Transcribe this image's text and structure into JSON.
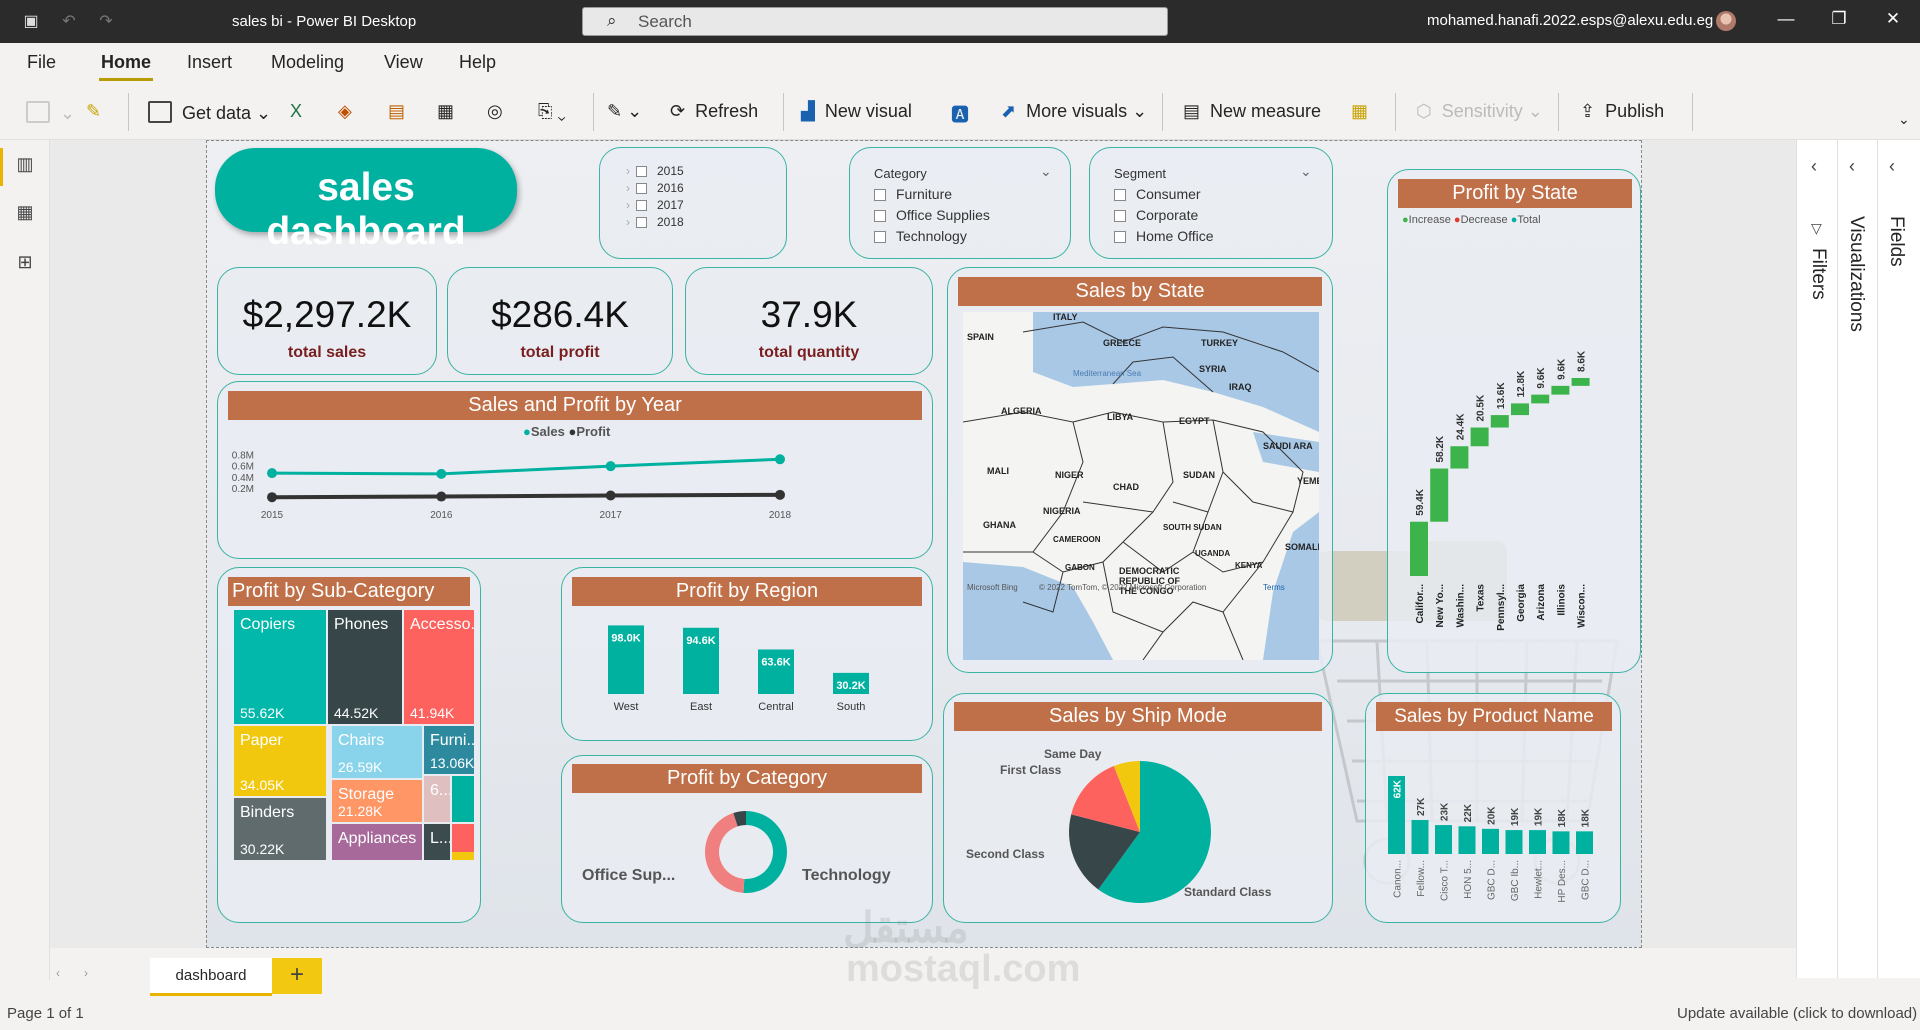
{
  "titlebar": {
    "title": "sales bi - Power BI Desktop",
    "search_placeholder": "Search",
    "user": "mohamed.hanafi.2022.esps@alexu.edu.eg"
  },
  "menu": [
    "File",
    "Home",
    "Insert",
    "Modeling",
    "View",
    "Help"
  ],
  "ribbon": {
    "get_data": "Get data",
    "refresh": "Refresh",
    "new_visual": "New visual",
    "more_visuals": "More visuals",
    "new_measure": "New measure",
    "sensitivity": "Sensitivity",
    "publish": "Publish"
  },
  "panes": {
    "filters": "Filters",
    "visualizations": "Visualizations",
    "fields": "Fields"
  },
  "dashboard": {
    "title": "sales dashboard"
  },
  "year_slicer": [
    "2015",
    "2016",
    "2017",
    "2018"
  ],
  "category_slicer": {
    "title": "Category",
    "items": [
      "Furniture",
      "Office Supplies",
      "Technology"
    ]
  },
  "segment_slicer": {
    "title": "Segment",
    "items": [
      "Consumer",
      "Corporate",
      "Home Office"
    ]
  },
  "kpis": [
    {
      "value": "$2,297.2K",
      "label": "total sales"
    },
    {
      "value": "$286.4K",
      "label": "total profit"
    },
    {
      "value": "37.9K",
      "label": "total quantity"
    }
  ],
  "sales_profit_year": {
    "title": "Sales and Profit by Year",
    "legend": [
      "Sales",
      "Profit"
    ],
    "yticks": [
      "0.8M",
      "0.6M",
      "0.4M",
      "0.2M"
    ]
  },
  "profit_by_subcategory": {
    "title": "Profit by Sub-Category"
  },
  "profit_by_region": {
    "title": "Profit by Region"
  },
  "profit_by_category": {
    "title": "Profit by Category",
    "labels": [
      "Office Sup...",
      "Technology"
    ]
  },
  "sales_by_state": {
    "title": "Sales by State",
    "map_labels": [
      "ITALY",
      "SPAIN",
      "GREECE",
      "TURKEY",
      "Mediterranean Sea",
      "SYRIA",
      "IRAQ",
      "ALGERIA",
      "LIBYA",
      "EGYPT",
      "SAUDI ARA",
      "MALI",
      "NIGER",
      "CHAD",
      "SUDAN",
      "YEME",
      "NIGERIA",
      "GHANA",
      "SOUTH SUDAN",
      "CAMEROON",
      "SOMALI",
      "UGANDA",
      "KENYA",
      "GABON",
      "DEMOCRATIC",
      "REPUBLIC OF",
      "THE CONGO"
    ],
    "attribution": "Microsoft Bing",
    "copyright": "© 2022 TomTom, © 2022 Microsoft Corporation",
    "terms": "Terms"
  },
  "profit_by_state": {
    "title": "Profit by State",
    "legend": [
      "Increase",
      "Decrease",
      "Total"
    ]
  },
  "sales_by_ship_mode": {
    "title": "Sales by Ship Mode",
    "labels": [
      "Same Day",
      "First Class",
      "Second Class",
      "Standard Class"
    ]
  },
  "sales_by_product": {
    "title": "Sales by Product Name"
  },
  "tabs": {
    "page": "dashboard",
    "add": "+"
  },
  "status": {
    "page": "Page 1 of 1",
    "update": "Update available (click to download)"
  },
  "watermark": {
    "arabic": "مستقل",
    "latin": "mostaql.com"
  },
  "colors": {
    "teal": "#00b1a0",
    "dark": "#374649",
    "red": "#fd625e",
    "yellow": "#f2c80f",
    "orange_banner": "#c07048",
    "green": "#3cb44b"
  },
  "chart_data": [
    {
      "type": "line",
      "title": "Sales and Profit by Year",
      "x": [
        "2015",
        "2016",
        "2017",
        "2018"
      ],
      "series": [
        {
          "name": "Sales",
          "values": [
            484000,
            470000,
            609000,
            733000
          ]
        },
        {
          "name": "Profit",
          "values": [
            50000,
            62000,
            81000,
            93000
          ]
        }
      ],
      "ylim": [
        0,
        900000
      ],
      "ytick_labels": [
        "0.2M",
        "0.4M",
        "0.6M",
        "0.8M"
      ]
    },
    {
      "type": "treemap",
      "title": "Profit by Sub-Category",
      "items": [
        {
          "name": "Copiers",
          "value": "55.62K",
          "color": "#01b8aa"
        },
        {
          "name": "Phones",
          "value": "44.52K",
          "color": "#374649"
        },
        {
          "name": "Accesso...",
          "value": "41.94K",
          "color": "#fd625e"
        },
        {
          "name": "Paper",
          "value": "34.05K",
          "color": "#f2c80f"
        },
        {
          "name": "Chairs",
          "value": "26.59K",
          "color": "#8ad4eb"
        },
        {
          "name": "Furni...",
          "value": "13.06K",
          "color": "#2d8a9e"
        },
        {
          "name": "Binders",
          "value": "30.22K",
          "color": "#5f6b6d"
        },
        {
          "name": "Storage",
          "value": "21.28K",
          "color": "#fe9666"
        },
        {
          "name": "Appliances",
          "value": "",
          "color": "#a66999"
        },
        {
          "name": "6...",
          "value": "",
          "color": "#dfbfbf"
        },
        {
          "name": "L...",
          "value": "",
          "color": "#3c4b4e"
        }
      ]
    },
    {
      "type": "bar",
      "title": "Profit by Region",
      "categories": [
        "West",
        "East",
        "Central",
        "South"
      ],
      "values": [
        98.0,
        94.6,
        63.6,
        30.2
      ],
      "labels": [
        "98.0K",
        "94.6K",
        "63.6K",
        "30.2K"
      ]
    },
    {
      "type": "pie",
      "title": "Profit by Category",
      "categories": [
        "Office Sup...",
        "Technology",
        "Furniture"
      ],
      "values": [
        44,
        51,
        5
      ]
    },
    {
      "type": "bar",
      "title": "Profit by State",
      "categories": [
        "Califor...",
        "New Yo...",
        "Washin...",
        "Texas",
        "Pennsyl...",
        "Georgia",
        "Arizona",
        "Illinois",
        "Wiscon..."
      ],
      "values": [
        59.4,
        58.2,
        24.4,
        20.5,
        13.6,
        12.8,
        9.6,
        9.6,
        8.6
      ],
      "labels": [
        "59.4K",
        "58.2K",
        "24.4K",
        "20.5K",
        "13.6K",
        "12.8K",
        "9.6K",
        "9.6K",
        "8.6K"
      ]
    },
    {
      "type": "pie",
      "title": "Sales by Ship Mode",
      "categories": [
        "Standard Class",
        "Second Class",
        "First Class",
        "Same Day"
      ],
      "values": [
        60,
        19,
        15,
        6
      ]
    },
    {
      "type": "bar",
      "title": "Sales by Product Name",
      "categories": [
        "Canon...",
        "Fellow...",
        "Cisco T...",
        "HON 5...",
        "GBC D...",
        "GBC Ib...",
        "Hewlet...",
        "HP Des...",
        "GBC D..."
      ],
      "values": [
        62,
        27,
        23,
        22,
        20,
        19,
        19,
        18,
        18
      ],
      "labels": [
        "62K",
        "27K",
        "23K",
        "22K",
        "20K",
        "19K",
        "19K",
        "18K",
        "18K"
      ]
    }
  ]
}
